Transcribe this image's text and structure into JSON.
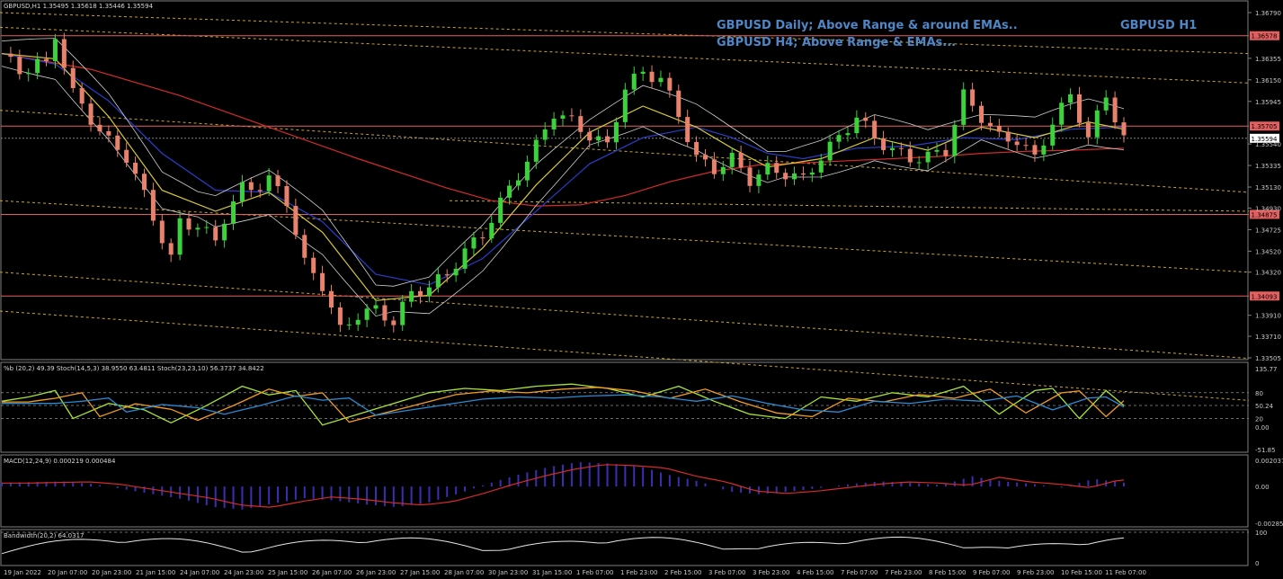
{
  "chart_data": {
    "type": "candlestick",
    "symbol_header": "GBPUSD,H1  1.35495 1.35618 1.35446 1.35594",
    "headlines": [
      "GBPUSD Daily; Above Range & around EMAs..",
      "GBPUSD H4; Above Range & EMAs..."
    ],
    "timeframe_label": "GBPUSD H1",
    "ylim": [
      1.33505,
      1.3679
    ],
    "price_ticks": [
      "1.36790",
      "1.36355",
      "1.36150",
      "1.35945",
      "1.35540",
      "1.35335",
      "1.35130",
      "1.34930",
      "1.34725",
      "1.34520",
      "1.34320",
      "1.33910",
      "1.33710",
      "1.33505"
    ],
    "marked_levels": [
      {
        "value": 1.3657,
        "label": "1.36578"
      },
      {
        "value": 1.3571,
        "label": "1.35705"
      },
      {
        "value": 1.35594,
        "label": "1.35594"
      },
      {
        "value": 1.3487,
        "label": "1.34875"
      },
      {
        "value": 1.34093,
        "label": "1.34093"
      }
    ],
    "time_labels": [
      "19 Jan 2022",
      "20 Jan 07:00",
      "20 Jan 23:00",
      "21 Jan 15:00",
      "24 Jan 07:00",
      "24 Jan 23:00",
      "25 Jan 15:00",
      "26 Jan 07:00",
      "26 Jan 23:00",
      "27 Jan 15:00",
      "28 Jan 07:00",
      "30 Jan 23:00",
      "31 Jan 15:00",
      "1 Feb 07:00",
      "1 Feb 23:00",
      "2 Feb 15:00",
      "3 Feb 07:00",
      "3 Feb 23:00",
      "4 Feb 15:00",
      "7 Feb 07:00",
      "7 Feb 23:00",
      "8 Feb 15:00",
      "9 Feb 07:00",
      "9 Feb 23:00",
      "10 Feb 15:00",
      "11 Feb 07:00"
    ],
    "close_path": [
      [
        0,
        1.364
      ],
      [
        2,
        1.3622
      ],
      [
        4,
        1.3632
      ],
      [
        5,
        1.3628
      ],
      [
        6,
        1.3658
      ],
      [
        8,
        1.3602
      ],
      [
        10,
        1.3578
      ],
      [
        12,
        1.3556
      ],
      [
        14,
        1.3542
      ],
      [
        16,
        1.3505
      ],
      [
        18,
        1.3464
      ],
      [
        19,
        1.3444
      ],
      [
        20,
        1.348
      ],
      [
        22,
        1.3476
      ],
      [
        24,
        1.3462
      ],
      [
        25,
        1.3484
      ],
      [
        27,
        1.3512
      ],
      [
        29,
        1.3514
      ],
      [
        30,
        1.352
      ],
      [
        32,
        1.35
      ],
      [
        34,
        1.344
      ],
      [
        36,
        1.342
      ],
      [
        38,
        1.3376
      ],
      [
        40,
        1.3392
      ],
      [
        42,
        1.3396
      ],
      [
        44,
        1.3385
      ],
      [
        46,
        1.3412
      ],
      [
        48,
        1.3418
      ],
      [
        50,
        1.343
      ],
      [
        52,
        1.3452
      ],
      [
        54,
        1.3468
      ],
      [
        56,
        1.3498
      ],
      [
        58,
        1.3525
      ],
      [
        60,
        1.3552
      ],
      [
        62,
        1.3584
      ],
      [
        64,
        1.3575
      ],
      [
        66,
        1.3562
      ],
      [
        68,
        1.3552
      ],
      [
        70,
        1.3608
      ],
      [
        72,
        1.3622
      ],
      [
        74,
        1.3616
      ],
      [
        76,
        1.3582
      ],
      [
        78,
        1.354
      ],
      [
        80,
        1.353
      ],
      [
        82,
        1.354
      ],
      [
        84,
        1.352
      ],
      [
        86,
        1.353
      ],
      [
        88,
        1.3526
      ],
      [
        90,
        1.352
      ],
      [
        92,
        1.3542
      ],
      [
        94,
        1.356
      ],
      [
        96,
        1.358
      ],
      [
        98,
        1.356
      ],
      [
        100,
        1.3548
      ],
      [
        102,
        1.354
      ],
      [
        104,
        1.3542
      ],
      [
        106,
        1.3548
      ],
      [
        108,
        1.36
      ],
      [
        110,
        1.358
      ],
      [
        112,
        1.356
      ],
      [
        114,
        1.3558
      ],
      [
        116,
        1.354
      ],
      [
        118,
        1.3575
      ],
      [
        120,
        1.36
      ],
      [
        122,
        1.356
      ],
      [
        124,
        1.36
      ],
      [
        125,
        1.358
      ],
      [
        126,
        1.3559
      ]
    ],
    "ma_paths": [
      {
        "color": "#d42b2b",
        "points": [
          [
            0,
            1.364
          ],
          [
            10,
            1.3625
          ],
          [
            20,
            1.36
          ],
          [
            30,
            1.357
          ],
          [
            40,
            1.354
          ],
          [
            50,
            1.3512
          ],
          [
            55,
            1.35
          ],
          [
            60,
            1.3495
          ],
          [
            65,
            1.3496
          ],
          [
            70,
            1.3505
          ],
          [
            75,
            1.3518
          ],
          [
            80,
            1.3528
          ],
          [
            85,
            1.3534
          ],
          [
            90,
            1.3536
          ],
          [
            95,
            1.3538
          ],
          [
            100,
            1.354
          ],
          [
            105,
            1.3542
          ],
          [
            110,
            1.3545
          ],
          [
            115,
            1.3547
          ],
          [
            120,
            1.3548
          ],
          [
            126,
            1.355
          ]
        ]
      },
      {
        "color": "#2a3ec8",
        "points": [
          [
            0,
            1.364
          ],
          [
            6,
            1.363
          ],
          [
            12,
            1.3595
          ],
          [
            18,
            1.3545
          ],
          [
            24,
            1.351
          ],
          [
            30,
            1.3508
          ],
          [
            36,
            1.348
          ],
          [
            42,
            1.343
          ],
          [
            48,
            1.342
          ],
          [
            54,
            1.3445
          ],
          [
            60,
            1.349
          ],
          [
            66,
            1.3535
          ],
          [
            72,
            1.356
          ],
          [
            78,
            1.357
          ],
          [
            82,
            1.356
          ],
          [
            86,
            1.3545
          ],
          [
            90,
            1.354
          ],
          [
            96,
            1.355
          ],
          [
            102,
            1.3552
          ],
          [
            108,
            1.356
          ],
          [
            114,
            1.3558
          ],
          [
            120,
            1.3568
          ],
          [
            126,
            1.357
          ]
        ]
      },
      {
        "color": "#d8c838",
        "points": [
          [
            0,
            1.364
          ],
          [
            6,
            1.3635
          ],
          [
            12,
            1.358
          ],
          [
            18,
            1.351
          ],
          [
            24,
            1.349
          ],
          [
            30,
            1.3508
          ],
          [
            36,
            1.347
          ],
          [
            42,
            1.3405
          ],
          [
            48,
            1.341
          ],
          [
            54,
            1.3455
          ],
          [
            60,
            1.3515
          ],
          [
            66,
            1.3565
          ],
          [
            72,
            1.359
          ],
          [
            78,
            1.357
          ],
          [
            82,
            1.355
          ],
          [
            86,
            1.3532
          ],
          [
            92,
            1.354
          ],
          [
            98,
            1.356
          ],
          [
            104,
            1.3548
          ],
          [
            110,
            1.357
          ],
          [
            116,
            1.356
          ],
          [
            122,
            1.3575
          ],
          [
            126,
            1.3568
          ]
        ]
      }
    ],
    "stoch_path": [
      [
        0,
        60
      ],
      [
        3,
        70
      ],
      [
        6,
        85
      ],
      [
        8,
        20
      ],
      [
        12,
        55
      ],
      [
        16,
        40
      ],
      [
        19,
        10
      ],
      [
        23,
        50
      ],
      [
        27,
        95
      ],
      [
        30,
        75
      ],
      [
        33,
        85
      ],
      [
        36,
        5
      ],
      [
        40,
        30
      ],
      [
        44,
        55
      ],
      [
        48,
        80
      ],
      [
        52,
        90
      ],
      [
        56,
        85
      ],
      [
        60,
        95
      ],
      [
        64,
        100
      ],
      [
        68,
        90
      ],
      [
        72,
        70
      ],
      [
        76,
        95
      ],
      [
        80,
        60
      ],
      [
        84,
        30
      ],
      [
        88,
        20
      ],
      [
        92,
        70
      ],
      [
        96,
        60
      ],
      [
        100,
        80
      ],
      [
        104,
        70
      ],
      [
        108,
        95
      ],
      [
        112,
        30
      ],
      [
        116,
        85
      ],
      [
        118,
        90
      ],
      [
        121,
        20
      ],
      [
        124,
        85
      ],
      [
        126,
        50
      ]
    ],
    "macd_hist": [
      0.0003,
      0.00035,
      0.0004,
      0.0002,
      -0.0002,
      -0.0006,
      -0.001,
      -0.0016,
      -0.0018,
      -0.0013,
      -0.0009,
      -0.0011,
      -0.0014,
      -0.0016,
      -0.0013,
      -0.0006,
      0.0002,
      0.0009,
      0.0015,
      0.0019,
      0.0018,
      0.0016,
      0.0009,
      0.0004,
      -0.0004,
      -0.0006,
      -0.0004,
      -0.0001,
      0.0002,
      0.0004,
      0.0003,
      0.0001,
      0.0008,
      0.0004,
      0.0002,
      -0.0001,
      0.0006,
      0.0003
    ],
    "stoch_header": "%b (20,2) 49.39  Stoch(14,5,3) 38.9550 63.4811  Stoch(23,23,10) 56.3737 34.8422",
    "stoch_ticks": [
      "135.77",
      "80",
      "50.24",
      "0.00",
      "20",
      "-51.85"
    ],
    "macd_header": "MACD(12,24,9) 0.000219 0.000484",
    "macd_ticks": [
      "0.002037",
      "0.00",
      "-0.002858"
    ],
    "bw_header": "Bandwidth(20,2) 64.0317",
    "bw_ticks": [
      "100",
      "0"
    ]
  },
  "colors": {
    "bull": "#3cd23c",
    "bear": "#e8826c",
    "level": "#e46060",
    "level_box": "#e46060",
    "dotted": "#c8a432",
    "stoch_green": "#a8e436",
    "stoch_orange": "#f29b22",
    "stoch_blue": "#2a8ad4",
    "macd_hist": "#3a2fb2",
    "macd_signal": "#d42b2b",
    "bandwidth": "#e6e6e6",
    "headline": "#4f86c6"
  }
}
